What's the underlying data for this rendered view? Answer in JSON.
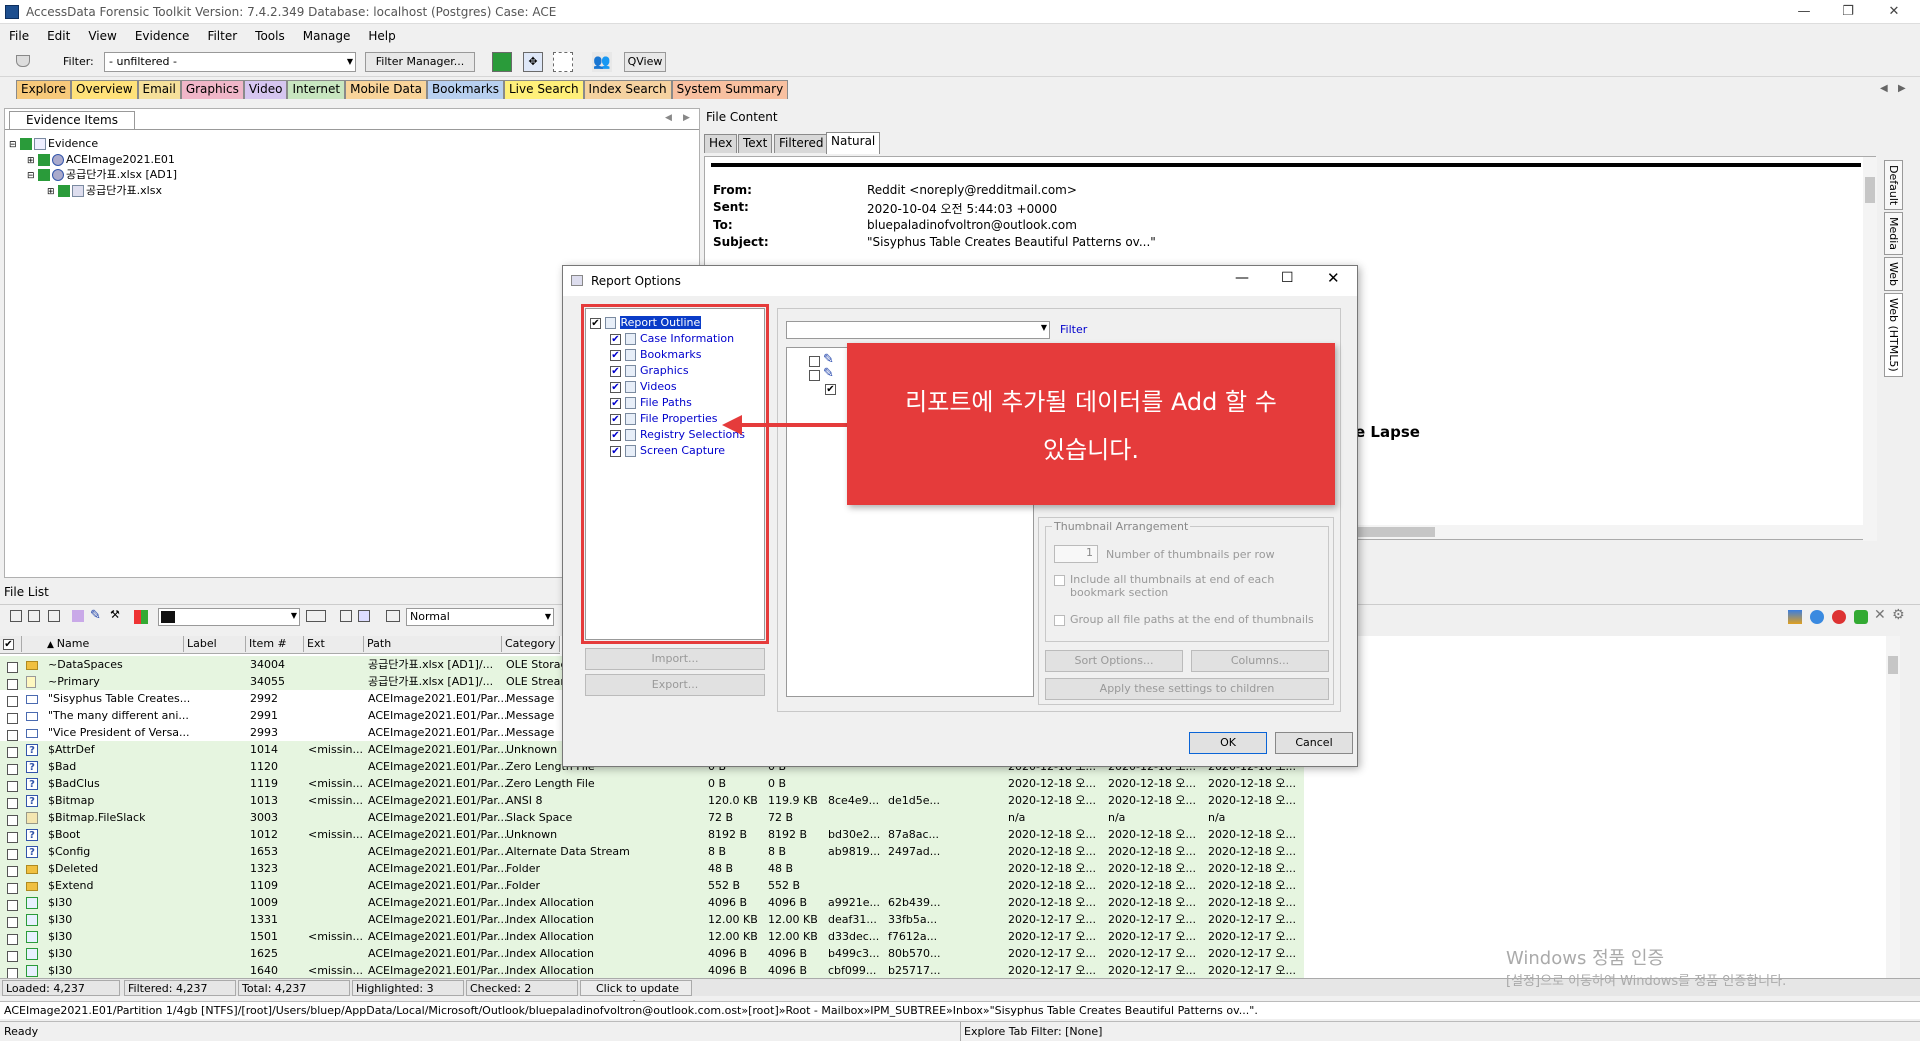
{
  "window": {
    "title": "AccessData Forensic Toolkit Version: 7.4.2.349 Database: localhost (Postgres) Case: ACE"
  },
  "menu": [
    "File",
    "Edit",
    "View",
    "Evidence",
    "Filter",
    "Tools",
    "Manage",
    "Help"
  ],
  "toolbar": {
    "filter_label": "Filter:",
    "filter_value": "- unfiltered -",
    "filter_manager": "Filter Manager...",
    "qview": "QView"
  },
  "tabs": [
    {
      "label": "Explore",
      "color": "#f7c97a"
    },
    {
      "label": "Overview",
      "color": "#ffe27a"
    },
    {
      "label": "Email",
      "color": "#f5e09a"
    },
    {
      "label": "Graphics",
      "color": "#f0b6c8"
    },
    {
      "label": "Video",
      "color": "#d6c6f0"
    },
    {
      "label": "Internet",
      "color": "#c8e6c0"
    },
    {
      "label": "Mobile Data",
      "color": "#f8d49a"
    },
    {
      "label": "Bookmarks",
      "color": "#b8d0f0"
    },
    {
      "label": "Live Search",
      "color": "#fff07a"
    },
    {
      "label": "Index Search",
      "color": "#f5d2a0"
    },
    {
      "label": "System Summary",
      "color": "#f8c0a0"
    }
  ],
  "evidence": {
    "panel_title": "Evidence Items",
    "tree": [
      "Evidence",
      "ACEImage2021.E01",
      "공급단가표.xlsx [AD1]",
      "공급단가표.xlsx"
    ]
  },
  "file_content": {
    "panel_title": "File Content",
    "tabs": [
      "Hex",
      "Text",
      "Filtered",
      "Natural"
    ],
    "headers": [
      {
        "k": "From:",
        "v": "Reddit <noreply@redditmail.com>"
      },
      {
        "k": "Sent:",
        "v": "2020-10-04 오전 5:44:03 +0000"
      },
      {
        "k": "To:",
        "v": "bluepaladinofvoltron@outlook.com"
      },
      {
        "k": "Subject:",
        "v": "\"Sisyphus Table Creates Beautiful Patterns ov...\""
      }
    ],
    "partial_text": "e Lapse",
    "side_tabs": [
      "Default",
      "Media",
      "Web",
      "Web (HTML5)"
    ]
  },
  "file_list": {
    "title": "File List",
    "view_mode": "Normal",
    "columns": [
      "Name",
      "Label",
      "Item #",
      "Ext",
      "Path",
      "Category"
    ],
    "rows": [
      {
        "name": "~DataSpaces",
        "label": "",
        "item": "34004",
        "ext": "",
        "path": "공급단가표.xlsx [AD1]/...",
        "cat": "OLE Storage",
        "c1": "",
        "c2": "",
        "c3": "",
        "c4": "",
        "d1": "",
        "d2": "",
        "d3": "",
        "icon": "folder",
        "green": true
      },
      {
        "name": "~Primary",
        "label": "",
        "item": "34055",
        "ext": "",
        "path": "공급단가표.xlsx [AD1]/...",
        "cat": "OLE Stream",
        "c1": "",
        "c2": "",
        "c3": "",
        "c4": "",
        "d1": "",
        "d2": "",
        "d3": "",
        "icon": "doc",
        "green": true
      },
      {
        "name": "\"Sisyphus Table Creates...",
        "label": "",
        "item": "2992",
        "ext": "",
        "path": "ACEImage2021.E01/Par...",
        "cat": "Message",
        "c1": "",
        "c2": "",
        "c3": "",
        "c4": "",
        "d1": "",
        "d2": "",
        "d3": "",
        "icon": "mail",
        "green": false
      },
      {
        "name": "\"The many different ani...",
        "label": "",
        "item": "2991",
        "ext": "",
        "path": "ACEImage2021.E01/Par...",
        "cat": "Message",
        "c1": "",
        "c2": "",
        "c3": "",
        "c4": "",
        "d1": "",
        "d2": "",
        "d3": "",
        "icon": "mail",
        "green": false
      },
      {
        "name": "\"Vice President of Versa...",
        "label": "",
        "item": "2993",
        "ext": "",
        "path": "ACEImage2021.E01/Par...",
        "cat": "Message",
        "c1": "",
        "c2": "",
        "c3": "",
        "c4": "",
        "d1": "",
        "d2": "",
        "d3": "",
        "icon": "mail",
        "green": false
      },
      {
        "name": "$AttrDef",
        "label": "",
        "item": "1014",
        "ext": "<missin...",
        "path": "ACEImage2021.E01/Par...",
        "cat": "Unknown",
        "c1": "",
        "c2": "",
        "c3": "",
        "c4": "",
        "d1": "",
        "d2": "",
        "d3": "",
        "icon": "q",
        "green": true
      },
      {
        "name": "$Bad",
        "label": "",
        "item": "1120",
        "ext": "",
        "path": "ACEImage2021.E01/Par...",
        "cat": "Zero Length File",
        "c1": "0 B",
        "c2": "0 B",
        "c3": "",
        "c4": "",
        "d1": "2020-12-18 오...",
        "d2": "2020-12-18 오...",
        "d3": "2020-12-18 오...",
        "icon": "q",
        "green": true
      },
      {
        "name": "$BadClus",
        "label": "",
        "item": "1119",
        "ext": "<missin...",
        "path": "ACEImage2021.E01/Par...",
        "cat": "Zero Length File",
        "c1": "0 B",
        "c2": "0 B",
        "c3": "",
        "c4": "",
        "d1": "2020-12-18 오...",
        "d2": "2020-12-18 오...",
        "d3": "2020-12-18 오...",
        "icon": "q",
        "green": true
      },
      {
        "name": "$Bitmap",
        "label": "",
        "item": "1013",
        "ext": "<missin...",
        "path": "ACEImage2021.E01/Par...",
        "cat": "ANSI 8",
        "c1": "120.0 KB",
        "c2": "119.9 KB",
        "c3": "8ce4e9...",
        "c4": "de1d5e...",
        "d1": "2020-12-18 오...",
        "d2": "2020-12-18 오...",
        "d3": "2020-12-18 오...",
        "icon": "q",
        "green": true
      },
      {
        "name": "$Bitmap.FileSlack",
        "label": "",
        "item": "3003",
        "ext": "",
        "path": "ACEImage2021.E01/Par...",
        "cat": "Slack Space",
        "c1": "72 B",
        "c2": "72 B",
        "c3": "",
        "c4": "",
        "d1": "n/a",
        "d2": "n/a",
        "d3": "n/a",
        "icon": "slack",
        "green": true
      },
      {
        "name": "$Boot",
        "label": "",
        "item": "1012",
        "ext": "<missin...",
        "path": "ACEImage2021.E01/Par...",
        "cat": "Unknown",
        "c1": "8192 B",
        "c2": "8192 B",
        "c3": "bd30e2...",
        "c4": "87a8ac...",
        "d1": "2020-12-18 오...",
        "d2": "2020-12-18 오...",
        "d3": "2020-12-18 오...",
        "icon": "q",
        "green": true
      },
      {
        "name": "$Config",
        "label": "",
        "item": "1653",
        "ext": "",
        "path": "ACEImage2021.E01/Par...",
        "cat": "Alternate Data Stream",
        "c1": "8 B",
        "c2": "8 B",
        "c3": "ab9819...",
        "c4": "2497ad...",
        "d1": "2020-12-18 오...",
        "d2": "2020-12-18 오...",
        "d3": "2020-12-18 오...",
        "icon": "q",
        "green": true
      },
      {
        "name": "$Deleted",
        "label": "",
        "item": "1323",
        "ext": "",
        "path": "ACEImage2021.E01/Par...",
        "cat": "Folder",
        "c1": "48 B",
        "c2": "48 B",
        "c3": "",
        "c4": "",
        "d1": "2020-12-18 오...",
        "d2": "2020-12-18 오...",
        "d3": "2020-12-18 오...",
        "icon": "folder",
        "green": true
      },
      {
        "name": "$Extend",
        "label": "",
        "item": "1109",
        "ext": "",
        "path": "ACEImage2021.E01/Par...",
        "cat": "Folder",
        "c1": "552 B",
        "c2": "552 B",
        "c3": "",
        "c4": "",
        "d1": "2020-12-18 오...",
        "d2": "2020-12-18 오...",
        "d3": "2020-12-18 오...",
        "icon": "folder",
        "green": true
      },
      {
        "name": "$I30",
        "label": "",
        "item": "1009",
        "ext": "",
        "path": "ACEImage2021.E01/Par...",
        "cat": "Index Allocation",
        "c1": "4096 B",
        "c2": "4096 B",
        "c3": "a9921e...",
        "c4": "62b439...",
        "d1": "2020-12-18 오...",
        "d2": "2020-12-18 오...",
        "d3": "2020-12-18 오...",
        "icon": "idx",
        "green": true
      },
      {
        "name": "$I30",
        "label": "",
        "item": "1331",
        "ext": "",
        "path": "ACEImage2021.E01/Par...",
        "cat": "Index Allocation",
        "c1": "12.00 KB",
        "c2": "12.00 KB",
        "c3": "deaf31...",
        "c4": "33fb5a...",
        "d1": "2020-12-17 오...",
        "d2": "2020-12-17 오...",
        "d3": "2020-12-17 오...",
        "icon": "idx",
        "green": true
      },
      {
        "name": "$I30",
        "label": "",
        "item": "1501",
        "ext": "<missin...",
        "path": "ACEImage2021.E01/Par...",
        "cat": "Index Allocation",
        "c1": "12.00 KB",
        "c2": "12.00 KB",
        "c3": "d33dec...",
        "c4": "f7612a...",
        "d1": "2020-12-17 오...",
        "d2": "2020-12-17 오...",
        "d3": "2020-12-17 오...",
        "icon": "idx",
        "green": true
      },
      {
        "name": "$I30",
        "label": "",
        "item": "1625",
        "ext": "",
        "path": "ACEImage2021.E01/Par...",
        "cat": "Index Allocation",
        "c1": "4096 B",
        "c2": "4096 B",
        "c3": "b499c3...",
        "c4": "80b570...",
        "d1": "2020-12-17 오...",
        "d2": "2020-12-17 오...",
        "d3": "2020-12-17 오...",
        "icon": "idx",
        "green": true
      },
      {
        "name": "$I30",
        "label": "",
        "item": "1640",
        "ext": "<missin...",
        "path": "ACEImage2021.E01/Par...",
        "cat": "Index Allocation",
        "c1": "4096 B",
        "c2": "4096 B",
        "c3": "cbf099...",
        "c4": "b25717...",
        "d1": "2020-12-17 오...",
        "d2": "2020-12-17 오...",
        "d3": "2020-12-17 오...",
        "icon": "idx",
        "green": true
      }
    ]
  },
  "status": {
    "loaded": "Loaded: 4,237",
    "filtered": "Filtered: 4,237",
    "total": "Total: 4,237",
    "highlighted": "Highlighted: 3",
    "checked": "Checked: 2",
    "update": "Click to update size",
    "path": "ACEImage2021.E01/Partition 1/4gb [NTFS]/[root]/Users/bluep/AppData/Local/Microsoft/Outlook/bluepaladinofvoltron@outlook.com.ost»[root]»Root - Mailbox»IPM_SUBTREE»Inbox»\"Sisyphus Table Creates Beautiful Patterns ov...\".",
    "ready": "Ready",
    "explore_filter": "Explore Tab Filter: [None]"
  },
  "dialog": {
    "title": "Report Options",
    "outline_root": "Report Outline",
    "outline_items": [
      "Case Information",
      "Bookmarks",
      "Graphics",
      "Videos",
      "File Paths",
      "File Properties",
      "Registry Selections",
      "Screen Capture"
    ],
    "import": "Import...",
    "export": "Export...",
    "filter_link": "Filter",
    "thumb_group": "Thumbnail Arrangement",
    "thumb_count": "1",
    "thumb_per_row": "Number of thumbnails per row",
    "thumb_include": "Include all thumbnails at end of each bookmark section",
    "group_paths": "Group all file paths at the end of thumbnails",
    "sort_options": "Sort Options...",
    "columns": "Columns...",
    "apply_children": "Apply these settings to children",
    "ok": "OK",
    "cancel": "Cancel"
  },
  "callout": {
    "line1": "리포트에 추가될 데이터를 Add 할 수",
    "line2": "있습니다."
  },
  "watermark": {
    "line1": "Windows 정품 인증",
    "line2": "[설정]으로 이동하여 Windows를 정품 인증합니다."
  },
  "colors": {
    "accent": "#e53b3b",
    "row_green": "#e6f5e0",
    "selection": "#0a3cc8"
  }
}
